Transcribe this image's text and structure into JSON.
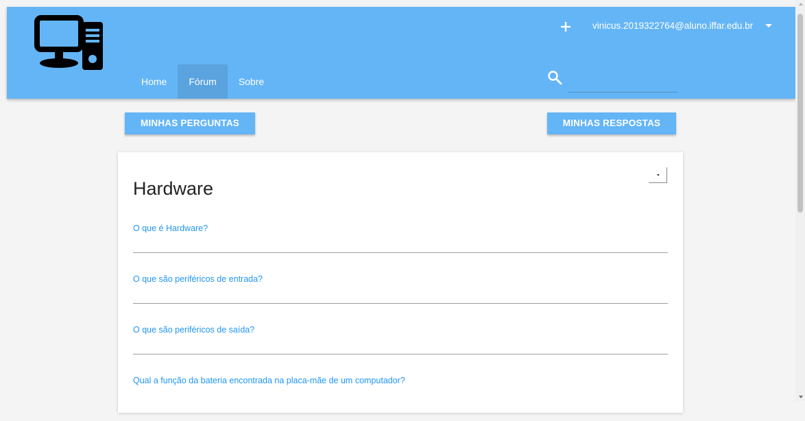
{
  "header": {
    "logo_icon": "computer-monitor-icon",
    "user_email": "vinicus.2019322764@aluno.iffar.edu.br",
    "add_icon": "plus-icon",
    "search": {
      "placeholder": "",
      "icon": "search-icon"
    },
    "nav": [
      {
        "label": "Home",
        "active": false
      },
      {
        "label": "Fórum",
        "active": true
      },
      {
        "label": "Sobre",
        "active": false
      }
    ]
  },
  "actions": {
    "my_questions": "MINHAS PERGUNTAS",
    "my_answers": "MINHAS RESPOSTAS"
  },
  "card": {
    "title": "Hardware",
    "questions": [
      "O que é Hardware?",
      "O que são periféricos de entrada?",
      "O que são periféricos de saída?",
      "Qual a função da bateria encontrada na placa-mãe de um computador?"
    ]
  },
  "colors": {
    "primary": "#64b5f6",
    "nav_active": "#5aa3de",
    "link": "#2196f3",
    "background": "#f4f4f4"
  }
}
